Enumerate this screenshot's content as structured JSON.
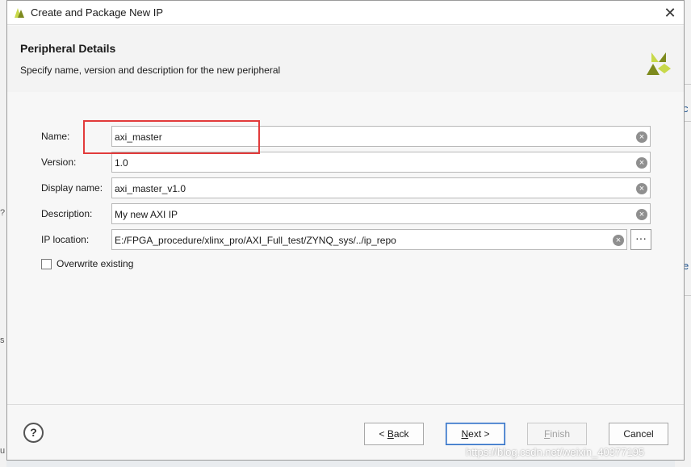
{
  "window": {
    "title": "Create and Package New IP",
    "close_symbol": "✕"
  },
  "header": {
    "title": "Peripheral Details",
    "subtitle": "Specify name, version and description for the new peripheral"
  },
  "form": {
    "name": {
      "label": "Name:",
      "value": "axi_master"
    },
    "version": {
      "label": "Version:",
      "value": "1.0"
    },
    "display_name": {
      "label": "Display name:",
      "value": "axi_master_v1.0"
    },
    "description": {
      "label": "Description:",
      "value": "My new AXI IP"
    },
    "ip_location": {
      "label": "IP location:",
      "value": "E:/FPGA_procedure/xlinx_pro/AXI_Full_test/ZYNQ_sys/../ip_repo",
      "browse_label": "···"
    },
    "overwrite": {
      "label": "Overwrite existing",
      "checked": false
    },
    "clear_symbol": "×"
  },
  "footer": {
    "help_label": "?",
    "back": {
      "prefix": "< ",
      "mnemonic": "B",
      "rest": "ack"
    },
    "next": {
      "mnemonic": "N",
      "rest": "ext >"
    },
    "finish": {
      "mnemonic": "F",
      "rest": "inish"
    },
    "cancel_label": "Cancel"
  },
  "background": {
    "right_frag_1": "c",
    "right_frag_2": "e",
    "left_frag_1": "?",
    "left_frag_2": "s",
    "left_frag_3": "u"
  },
  "watermark": "https://blog.csdn.net/weixin_40377195",
  "colors": {
    "highlight": "#e23b3b",
    "logo_light": "#c8d94a",
    "logo_dark": "#7d8a1e",
    "primary_border": "#2d6dc4"
  }
}
